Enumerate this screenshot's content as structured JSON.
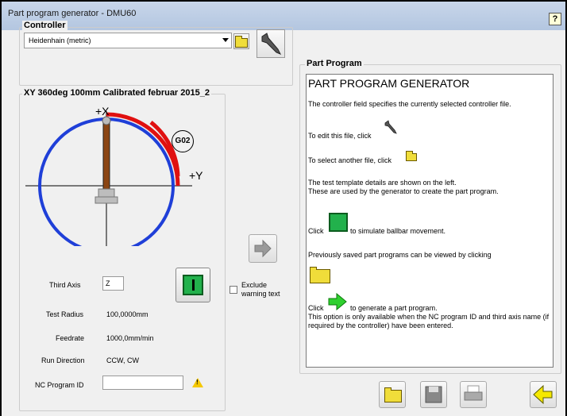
{
  "window": {
    "title": "Part program generator - DMU60"
  },
  "controller": {
    "group_title": "Controller",
    "selected": "Heidenhain (metric)"
  },
  "test": {
    "group_title": "XY 360deg 100mm Calibrated februar 2015_2",
    "axis_x": "+X",
    "axis_y": "+Y",
    "gcode_badge": "G02",
    "third_axis_label": "Third Axis",
    "third_axis_value": "Z",
    "test_radius_label": "Test Radius",
    "test_radius_value": "100,0000mm",
    "feedrate_label": "Feedrate",
    "feedrate_value": "1000,0mm/min",
    "run_direction_label": "Run Direction",
    "run_direction_value": "CCW, CW",
    "nc_program_label": "NC Program ID",
    "nc_program_value": "",
    "exclude_warning_label": "Exclude warning text"
  },
  "part_program": {
    "group_title": "Part Program",
    "heading": "PART PROGRAM GENERATOR",
    "p1": "The controller field specifies the currently selected controller file.",
    "p2": "To edit this file, click",
    "p3": "To select another file, click",
    "p4a": "The test template details are shown on the left.",
    "p4b": "These are used by the generator to create the part program.",
    "p5a": "Click",
    "p5b": "to simulate ballbar movement.",
    "p6": "Previously saved part programs can be viewed by clicking",
    "p7a": "Click",
    "p7b": "to generate a part program.",
    "p7c": "This option is only available when the NC program ID and third axis name (if required by the controller) have been entered."
  },
  "icons": {
    "help": "help-icon",
    "folder": "folder-icon",
    "wrench": "wrench-icon",
    "simulate": "simulate-icon",
    "generate": "arrow-right-icon",
    "save": "save-icon",
    "print": "print-icon",
    "back": "arrow-left-icon",
    "warning": "warning-icon"
  },
  "colors": {
    "circle": "#1f3fd8",
    "arc": "#e01010",
    "sim_green": "#22b14c",
    "generate_green": "#2fd02f",
    "folder_yellow": "#f0dd3a",
    "back_yellow": "#f5e800"
  }
}
